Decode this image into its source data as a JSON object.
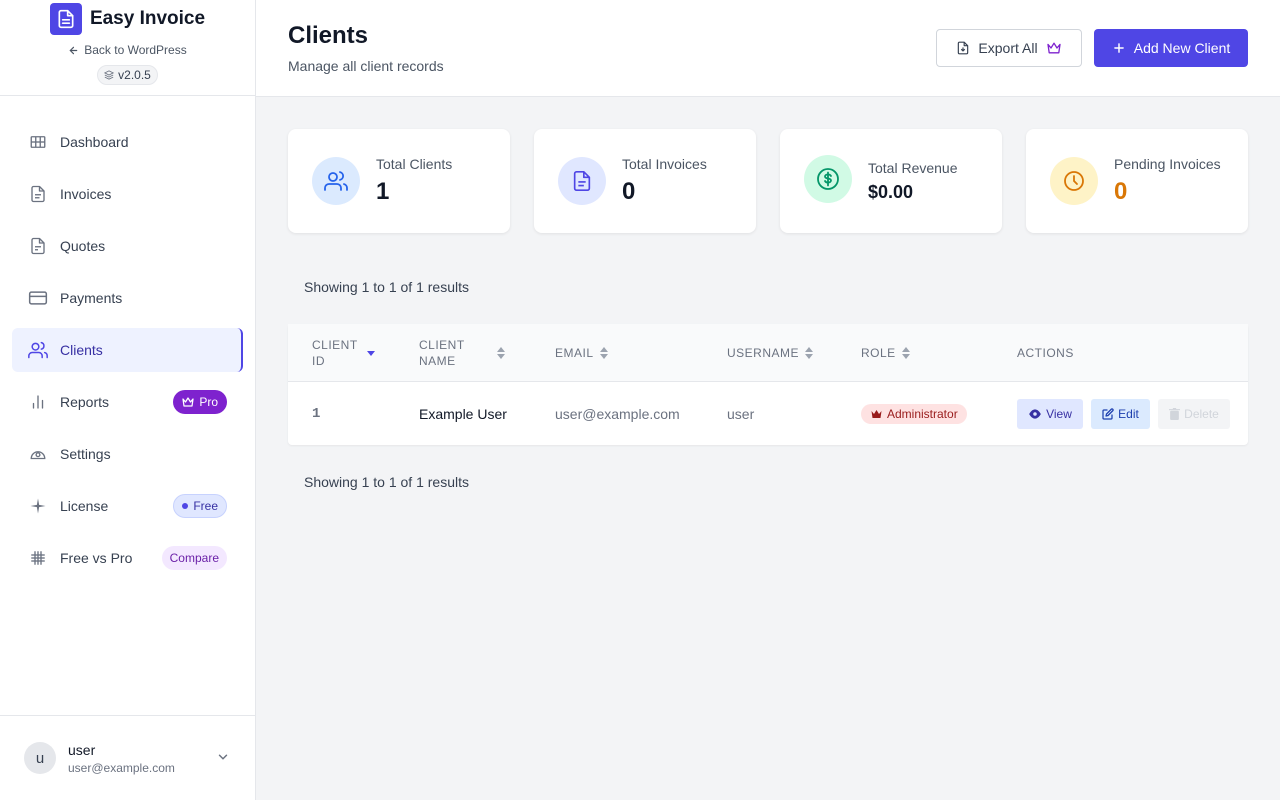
{
  "brand": {
    "name": "Easy Invoice",
    "back_link": "Back to WordPress",
    "version": "v2.0.5"
  },
  "sidebar": {
    "items": [
      {
        "label": "Dashboard",
        "icon": "grid-icon"
      },
      {
        "label": "Invoices",
        "icon": "document-icon"
      },
      {
        "label": "Quotes",
        "icon": "document-icon"
      },
      {
        "label": "Payments",
        "icon": "credit-card-icon"
      },
      {
        "label": "Clients",
        "icon": "users-icon",
        "active": true
      },
      {
        "label": "Reports",
        "icon": "bar-chart-icon",
        "badge": "Pro"
      },
      {
        "label": "Settings",
        "icon": "gear-icon"
      },
      {
        "label": "License",
        "icon": "sparkle-icon",
        "badge": "Free"
      },
      {
        "label": "Free vs Pro",
        "icon": "hash-icon",
        "badge": "Compare"
      }
    ]
  },
  "user": {
    "initial": "u",
    "name": "user",
    "email": "user@example.com"
  },
  "header": {
    "title": "Clients",
    "subtitle": "Manage all client records",
    "export_label": "Export All",
    "add_label": "Add New Client"
  },
  "stats": [
    {
      "label": "Total Clients",
      "value": "1"
    },
    {
      "label": "Total Invoices",
      "value": "0"
    },
    {
      "label": "Total Revenue",
      "value": "$0.00"
    },
    {
      "label": "Pending Invoices",
      "value": "0"
    }
  ],
  "results_text": "Showing 1 to 1 of 1 results",
  "table": {
    "columns": [
      "Client ID",
      "Client Name",
      "Email",
      "Username",
      "Role",
      "Actions"
    ],
    "rows": [
      {
        "id": "1",
        "name": "Example User",
        "email": "user@example.com",
        "username": "user",
        "role": "Administrator"
      }
    ],
    "actions": {
      "view": "View",
      "edit": "Edit",
      "delete": "Delete"
    }
  },
  "colors": {
    "accent": "#4f46e5",
    "pro": "#7e22ce",
    "pending": "#d97706",
    "revenue": "#059669"
  }
}
